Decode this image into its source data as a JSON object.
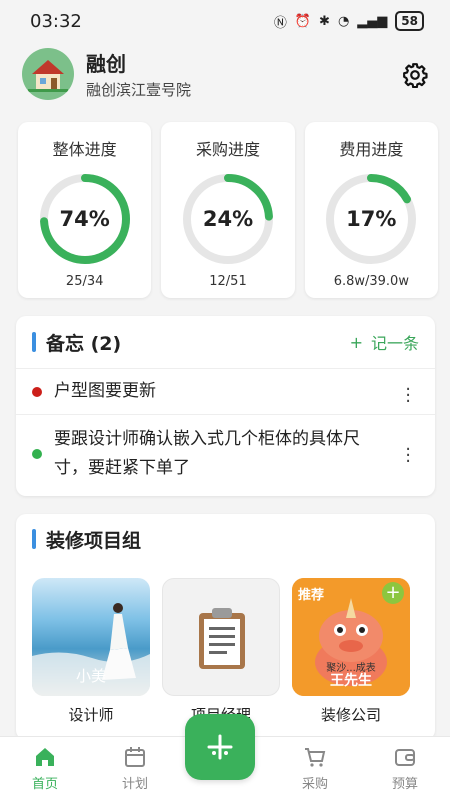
{
  "status_bar": {
    "time": "03:32",
    "battery": "58"
  },
  "header": {
    "title": "融创",
    "subtitle": "融创滨江壹号院"
  },
  "progress_cards": [
    {
      "title": "整体进度",
      "percent": 74,
      "percent_label": "74%",
      "detail": "25/34"
    },
    {
      "title": "采购进度",
      "percent": 24,
      "percent_label": "24%",
      "detail": "12/51"
    },
    {
      "title": "费用进度",
      "percent": 17,
      "percent_label": "17%",
      "detail": "6.8w/39.0w"
    }
  ],
  "memo": {
    "title": "备忘 (2)",
    "add_label": "记一条",
    "items": [
      {
        "text": "户型图要更新",
        "color": "#cc1f1a"
      },
      {
        "text": "要跟设计师确认嵌入式几个柜体的具体尺寸，要赶紧下单了",
        "color": "#33b14f"
      }
    ]
  },
  "group": {
    "title": "装修项目组",
    "members": [
      {
        "role": "设计师",
        "overlay_name": "小美"
      },
      {
        "role": "项目经理"
      },
      {
        "role": "装修公司",
        "badge": "推荐",
        "overlay_name": "王先生",
        "banner": "聚沙...成表"
      }
    ]
  },
  "tabs": [
    {
      "label": "首页",
      "active": true
    },
    {
      "label": "计划"
    },
    {
      "label": "采购"
    },
    {
      "label": "预算"
    }
  ],
  "colors": {
    "accent": "#3ab15b",
    "ring_track": "#e6e6e6",
    "memo_bar": "#3b8fe0"
  }
}
